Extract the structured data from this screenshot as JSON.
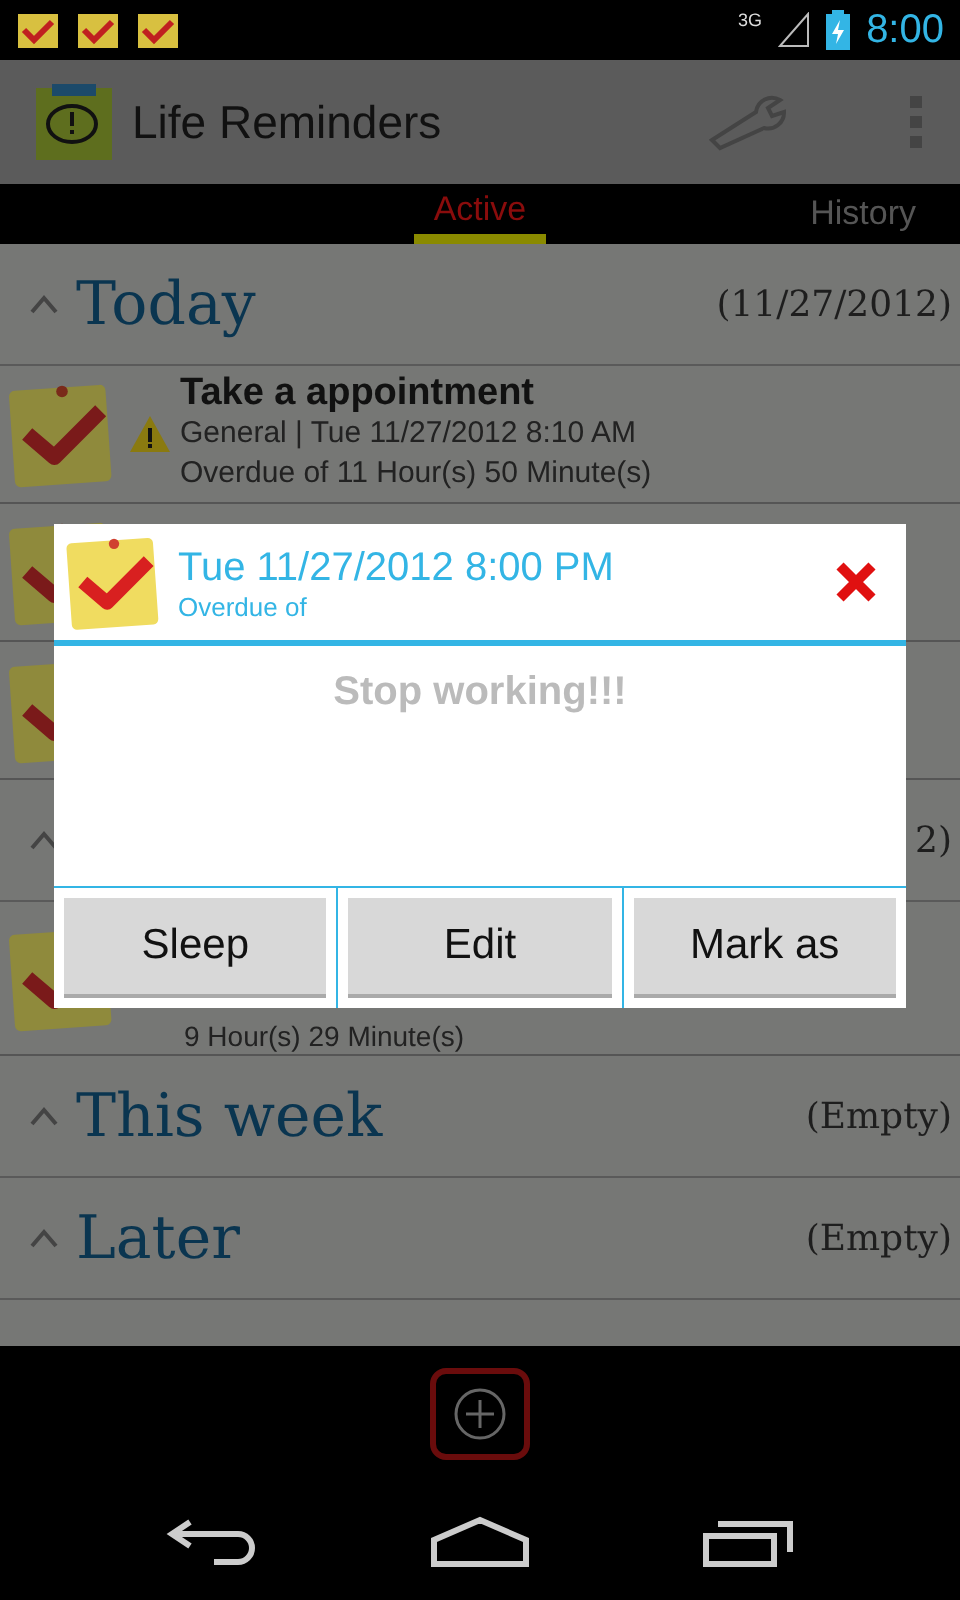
{
  "status_bar": {
    "network": "3G",
    "time": "8:00"
  },
  "app_bar": {
    "title": "Life Reminders"
  },
  "tabs": [
    {
      "label": "Active",
      "selected": true
    },
    {
      "label": "History",
      "selected": false
    }
  ],
  "sections": [
    {
      "title": "Today",
      "summary": "(11/27/2012)",
      "items": [
        {
          "title": "Take a appointment",
          "warning": true,
          "details": "General  |  Tue 11/27/2012 8:10 AM",
          "overdue": "Overdue of 11 Hour(s) 50 Minute(s)"
        },
        {
          "warning": false
        },
        {
          "warning": false
        }
      ]
    },
    {
      "summary": "2)",
      "items": [
        {
          "warning": false,
          "overdue": "9 Hour(s) 29 Minute(s)"
        }
      ]
    },
    {
      "title": "This week",
      "summary": "(Empty)"
    },
    {
      "title": "Later",
      "summary": "(Empty)"
    }
  ],
  "dialog": {
    "time": "Tue 11/27/2012 8:00 PM",
    "subtitle": "Overdue of",
    "message": "Stop working!!!",
    "buttons": [
      "Sleep",
      "Edit",
      "Mark as"
    ]
  }
}
